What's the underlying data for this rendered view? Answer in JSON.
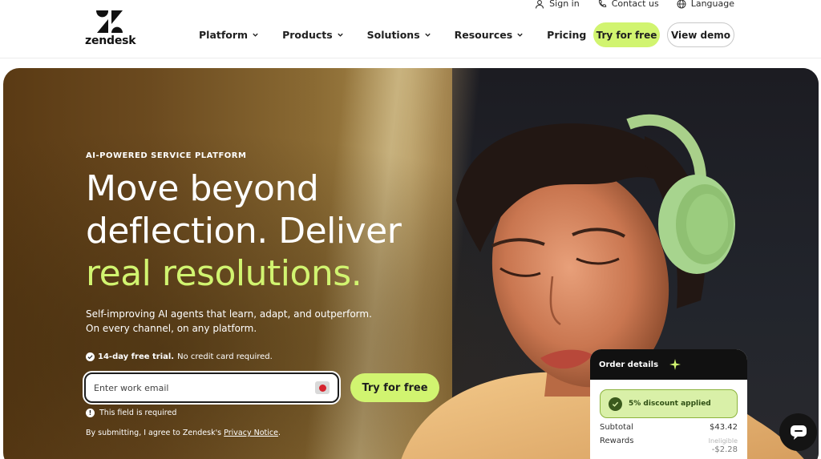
{
  "utility": {
    "sign_in": "Sign in",
    "contact_us": "Contact us",
    "language": "Language"
  },
  "logo": {
    "wordmark": "zendesk"
  },
  "nav": {
    "platform": "Platform",
    "products": "Products",
    "solutions": "Solutions",
    "resources": "Resources",
    "pricing": "Pricing"
  },
  "header_buttons": {
    "try_free": "Try for free",
    "view_demo": "View demo"
  },
  "hero": {
    "eyebrow": "AI-POWERED SERVICE PLATFORM",
    "headline_line1": "Move beyond",
    "headline_line2": "deflection. Deliver",
    "headline_accent": "real resolutions.",
    "subtext_line1": "Self-improving AI agents that learn, adapt, and outperform.",
    "subtext_line2": "On every channel, on any platform.",
    "trial_bold": "14-day free trial.",
    "trial_rest": "No credit card required.",
    "email_placeholder": "Enter work email",
    "cta": "Try for free",
    "error": "This field is required",
    "legal_prefix": "By submitting, I agree to Zendesk's",
    "legal_link": "Privacy Notice",
    "legal_suffix": "."
  },
  "order_card": {
    "title": "Order details",
    "discount": "5% discount applied",
    "subtotal_label": "Subtotal",
    "subtotal_value": "$43.42",
    "rewards_label": "Rewards",
    "rewards_note": "Ineligible",
    "rewards_value": "-$2.28"
  },
  "colors": {
    "accent": "#d1f470",
    "dark": "#111111"
  }
}
